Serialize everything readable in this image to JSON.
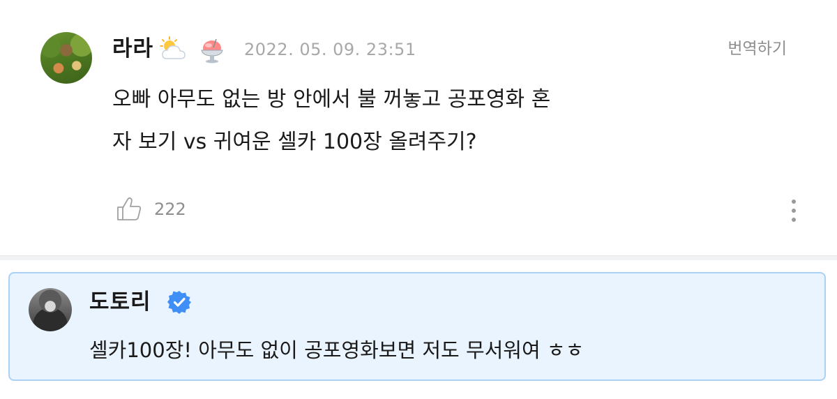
{
  "comment": {
    "username": "라라",
    "badges": [
      "sun-behind-cloud-emoji",
      "shaved-ice-emoji"
    ],
    "timestamp": "2022. 05. 09. 23:51",
    "translate_label": "번역하기",
    "body_lines": [
      "오빠 아무도 없는 방 안에서 불 꺼놓고 공포영화 혼",
      "자 보기 vs 귀여운 셀카 100장 올려주기?"
    ],
    "like_icon": "thumbs-up-outline-icon",
    "like_count": "222",
    "more_icon": "vertical-ellipsis-icon"
  },
  "reply": {
    "username": "도토리",
    "verified_icon": "verified-check-badge-icon",
    "body": "셀카100장! 아무도 없이 공포영화보면 저도 무서워여 ㅎㅎ"
  },
  "colors": {
    "reply_background": "#eaf4fe",
    "reply_border": "#a9d2f6",
    "verified_blue": "#3f8ff7",
    "muted_text": "#a8a8a8",
    "divider": "#f1f2f4"
  }
}
